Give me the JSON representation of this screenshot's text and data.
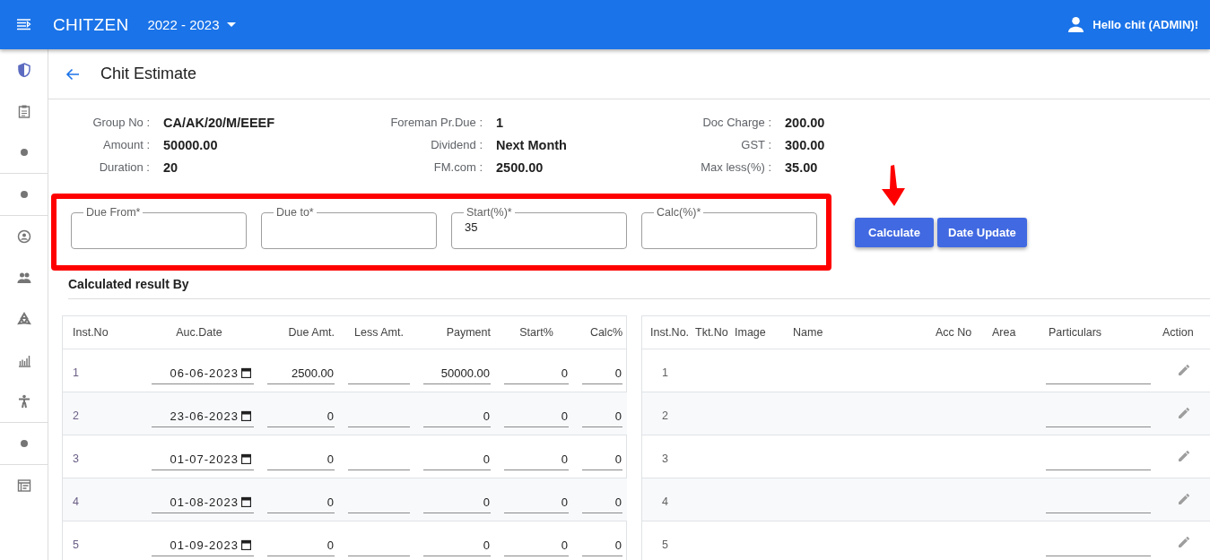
{
  "app": {
    "title": "CHITZEN",
    "year": "2022 - 2023",
    "user": "Hello chit (ADMIN)!"
  },
  "page": {
    "title": "Chit Estimate"
  },
  "details": [
    [
      {
        "label": "Group No :",
        "value": "CA/AK/20/M/EEEF"
      },
      {
        "label": "Amount :",
        "value": "50000.00"
      },
      {
        "label": "Duration :",
        "value": "20"
      }
    ],
    [
      {
        "label": "Foreman Pr.Due :",
        "value": "1"
      },
      {
        "label": "Dividend :",
        "value": "Next Month"
      },
      {
        "label": "FM.com :",
        "value": "2500.00"
      }
    ],
    [
      {
        "label": "Doc Charge :",
        "value": "200.00"
      },
      {
        "label": "GST :",
        "value": "300.00"
      },
      {
        "label": "Max less(%) :",
        "value": "35.00"
      }
    ]
  ],
  "fields": [
    {
      "label": "Due From*"
    },
    {
      "label": "Due to*"
    },
    {
      "label": "Start(%)*",
      "value": "35"
    },
    {
      "label": "Calc(%)*"
    }
  ],
  "buttons": [
    "Calculate",
    "Date Update"
  ],
  "section_title": "Calculated result By",
  "estimate_table": {
    "columns": [
      "Inst.No",
      "Auc.Date",
      "Due Amt.",
      "Less Amt.",
      "Payment",
      "Start%",
      "Calc%"
    ],
    "rows": [
      {
        "inst_no": "1",
        "auc_date": "06-06-2023",
        "due_amt": "2500.00",
        "payment": "50000.00",
        "start_pct": "0",
        "calc_pct": "0"
      },
      {
        "inst_no": "2",
        "auc_date": "23-06-2023",
        "due_amt": "0",
        "payment": "0",
        "start_pct": "0",
        "calc_pct": "0"
      },
      {
        "inst_no": "3",
        "auc_date": "01-07-2023",
        "due_amt": "0",
        "payment": "0",
        "start_pct": "0",
        "calc_pct": "0"
      },
      {
        "inst_no": "4",
        "auc_date": "01-08-2023",
        "due_amt": "0",
        "payment": "0",
        "start_pct": "0",
        "calc_pct": "0"
      },
      {
        "inst_no": "5",
        "auc_date": "01-09-2023",
        "due_amt": "0",
        "payment": "0",
        "start_pct": "0",
        "calc_pct": "0"
      }
    ]
  },
  "members_table": {
    "columns": [
      "Inst.No.",
      "Tkt.No",
      "Image",
      "Name",
      "Acc No",
      "Area",
      "Particulars",
      "Action"
    ],
    "rows": [
      {
        "inst_no": "1"
      },
      {
        "inst_no": "2"
      },
      {
        "inst_no": "3"
      },
      {
        "inst_no": "4"
      },
      {
        "inst_no": "5"
      }
    ]
  }
}
